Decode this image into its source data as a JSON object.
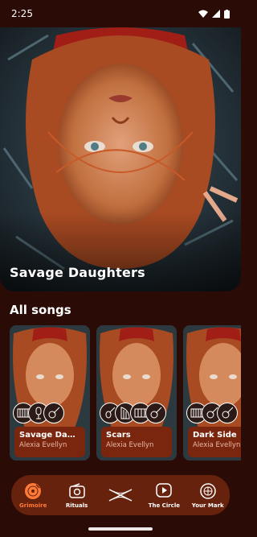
{
  "status_bar": {
    "time": "2:25"
  },
  "hero": {
    "title": "Savage Daughters"
  },
  "section": {
    "title": "All songs"
  },
  "songs": [
    {
      "title": "Savage Daughters",
      "artist": "Alexia Evellyn",
      "instrument_icons": [
        "keyboard-icon",
        "microphone-icon",
        "guitar-icon"
      ]
    },
    {
      "title": "Scars",
      "artist": "Alexia Evellyn",
      "instrument_icons": [
        "violin-icon",
        "harp-icon",
        "piano-icon",
        "guitar-icon"
      ]
    },
    {
      "title": "Dark Side",
      "artist": "Alexia Evellyn",
      "instrument_icons": [
        "keyboard-icon",
        "guitar-icon",
        "guitar-icon"
      ]
    }
  ],
  "nav": {
    "items": [
      {
        "label": "Grimoire",
        "icon": "vinyl-icon",
        "active": true
      },
      {
        "label": "Rituals",
        "icon": "radio-icon",
        "active": false
      },
      {
        "label": "",
        "icon": "crossed-wands-icon",
        "active": false
      },
      {
        "label": "The Circle",
        "icon": "play-badge-icon",
        "active": false
      },
      {
        "label": "Your Mark",
        "icon": "coin-icon",
        "active": false
      }
    ]
  },
  "colors": {
    "background": "#2a0b06",
    "nav_bg": "#66220d",
    "accent": "#ff7a36",
    "card_info": "#7a260e"
  }
}
